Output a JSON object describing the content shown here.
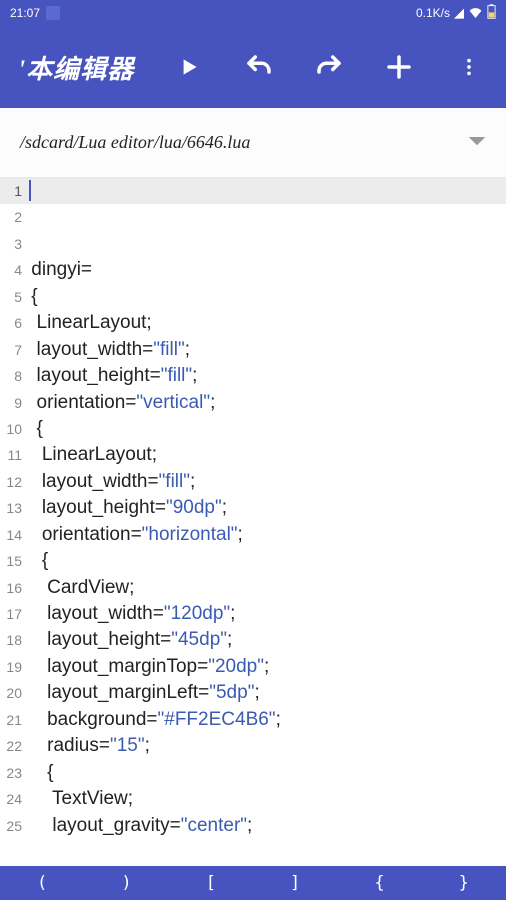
{
  "status": {
    "time": "21:07",
    "speed": "0.1K/s",
    "icons": [
      "signal-icon",
      "wifi-icon",
      "battery-icon"
    ]
  },
  "appbar": {
    "title": "'本编辑器"
  },
  "path": {
    "text": "/sdcard/Lua editor/lua/6646.lua"
  },
  "code": {
    "lines": [
      {
        "n": 1,
        "current": true,
        "tokens": []
      },
      {
        "n": 2,
        "tokens": []
      },
      {
        "n": 3,
        "tokens": []
      },
      {
        "n": 4,
        "tokens": [
          {
            "t": " dingyi="
          }
        ]
      },
      {
        "n": 5,
        "tokens": [
          {
            "t": " {"
          }
        ]
      },
      {
        "n": 6,
        "tokens": [
          {
            "t": "  LinearLayout;"
          }
        ]
      },
      {
        "n": 7,
        "tokens": [
          {
            "t": "  layout_width="
          },
          {
            "t": "\"fill\"",
            "c": "s"
          },
          {
            "t": ";"
          }
        ]
      },
      {
        "n": 8,
        "tokens": [
          {
            "t": "  layout_height="
          },
          {
            "t": "\"fill\"",
            "c": "s"
          },
          {
            "t": ";"
          }
        ]
      },
      {
        "n": 9,
        "tokens": [
          {
            "t": "  orientation="
          },
          {
            "t": "\"vertical\"",
            "c": "s"
          },
          {
            "t": ";"
          }
        ]
      },
      {
        "n": 10,
        "tokens": [
          {
            "t": "  {"
          }
        ]
      },
      {
        "n": 11,
        "tokens": [
          {
            "t": "   LinearLayout;"
          }
        ]
      },
      {
        "n": 12,
        "tokens": [
          {
            "t": "   layout_width="
          },
          {
            "t": "\"fill\"",
            "c": "s"
          },
          {
            "t": ";"
          }
        ]
      },
      {
        "n": 13,
        "tokens": [
          {
            "t": "   layout_height="
          },
          {
            "t": "\"90dp\"",
            "c": "s"
          },
          {
            "t": ";"
          }
        ]
      },
      {
        "n": 14,
        "tokens": [
          {
            "t": "   orientation="
          },
          {
            "t": "\"horizontal\"",
            "c": "s"
          },
          {
            "t": ";"
          }
        ]
      },
      {
        "n": 15,
        "tokens": [
          {
            "t": "   {"
          }
        ]
      },
      {
        "n": 16,
        "tokens": [
          {
            "t": "    CardView;"
          }
        ]
      },
      {
        "n": 17,
        "tokens": [
          {
            "t": "    layout_width="
          },
          {
            "t": "\"120dp\"",
            "c": "s"
          },
          {
            "t": ";"
          }
        ]
      },
      {
        "n": 18,
        "tokens": [
          {
            "t": "    layout_height="
          },
          {
            "t": "\"45dp\"",
            "c": "s"
          },
          {
            "t": ";"
          }
        ]
      },
      {
        "n": 19,
        "tokens": [
          {
            "t": "    layout_marginTop="
          },
          {
            "t": "\"20dp\"",
            "c": "s"
          },
          {
            "t": ";"
          }
        ]
      },
      {
        "n": 20,
        "tokens": [
          {
            "t": "    layout_marginLeft="
          },
          {
            "t": "\"5dp\"",
            "c": "s"
          },
          {
            "t": ";"
          }
        ]
      },
      {
        "n": 21,
        "tokens": [
          {
            "t": "    background="
          },
          {
            "t": "\"#FF2EC4B6\"",
            "c": "s"
          },
          {
            "t": ";"
          }
        ]
      },
      {
        "n": 22,
        "tokens": [
          {
            "t": "    radius="
          },
          {
            "t": "\"15\"",
            "c": "s"
          },
          {
            "t": ";"
          }
        ]
      },
      {
        "n": 23,
        "tokens": [
          {
            "t": "    {"
          }
        ]
      },
      {
        "n": 24,
        "tokens": [
          {
            "t": "     TextView;"
          }
        ]
      },
      {
        "n": 25,
        "tokens": [
          {
            "t": "     layout_gravity="
          },
          {
            "t": "\"center\"",
            "c": "s"
          },
          {
            "t": ";"
          }
        ]
      }
    ]
  },
  "symbols": [
    "(",
    ")",
    "[",
    "]",
    "{",
    "}"
  ]
}
